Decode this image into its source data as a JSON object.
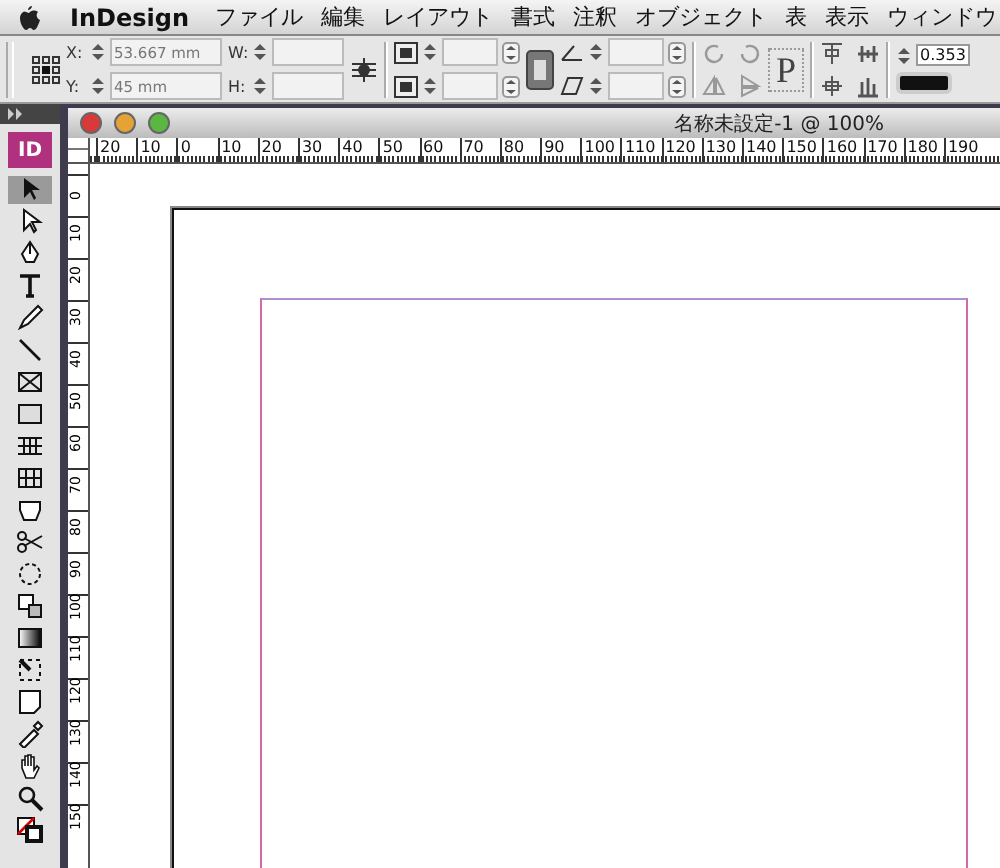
{
  "menu_bar": {
    "app": "InDesign",
    "items": [
      "ファイル",
      "編集",
      "レイアウト",
      "書式",
      "注釈",
      "オブジェクト",
      "表",
      "表示",
      "ウィンドウ"
    ]
  },
  "control_panel": {
    "fields": [
      {
        "label": "X:",
        "value": "53.667 mm"
      },
      {
        "label": "Y:",
        "value": "45 mm"
      },
      {
        "label": "W:"
      },
      {
        "label": "H:"
      }
    ],
    "paragraph_mark": "P",
    "stroke_weight": "0.353"
  },
  "toolbox": {
    "logo": "ID",
    "tools": [
      {
        "selected": true
      },
      {
        "selected": false
      },
      {
        "selected": false
      },
      {
        "selected": false
      },
      {
        "selected": false
      },
      {
        "selected": false
      },
      {
        "selected": false
      },
      {
        "selected": false
      },
      {
        "selected": false
      },
      {
        "selected": false
      },
      {
        "selected": false
      },
      {
        "selected": false
      },
      {
        "selected": false
      },
      {
        "selected": false
      },
      {
        "selected": false
      },
      {
        "selected": false
      },
      {
        "selected": false
      },
      {
        "selected": false
      },
      {
        "selected": false
      },
      {
        "selected": false
      },
      {
        "selected": false
      }
    ]
  },
  "document": {
    "title": "名称未設定-1 @ 100%",
    "horizontal_ruler": [
      "20",
      "10",
      "0",
      "10",
      "20",
      "30",
      "40",
      "50",
      "60",
      "70",
      "80",
      "90",
      "100",
      "110",
      "120",
      "130",
      "140",
      "150",
      "160",
      "170",
      "180",
      "190"
    ],
    "vertical_ruler": [
      "0",
      "10",
      "20",
      "30",
      "40",
      "50",
      "60",
      "70",
      "80",
      "90",
      "100",
      "110",
      "120",
      "130",
      "140",
      "150"
    ]
  }
}
